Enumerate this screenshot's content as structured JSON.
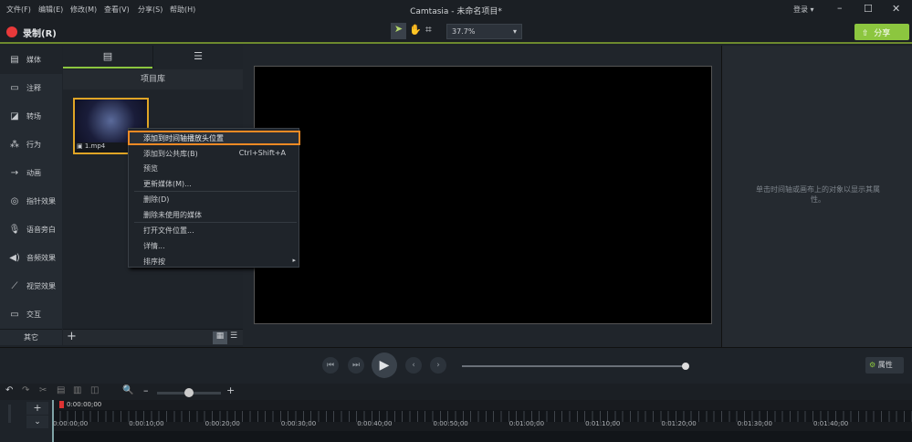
{
  "menu": [
    "文件(F)",
    "编辑(E)",
    "修改(M)",
    "查看(V)",
    "分享(S)",
    "帮助(H)"
  ],
  "title": "Camtasia - 未命名项目*",
  "login": "登录 ▾",
  "record": "录制(R)",
  "zoom": "37.7%",
  "share": "分享",
  "sidebar": [
    "媒体",
    "注释",
    "转场",
    "行为",
    "动画",
    "指针效果",
    "语音旁白",
    "音频效果",
    "视觉效果",
    "交互"
  ],
  "sidebar_more": "其它",
  "media": {
    "header": "项目库",
    "clip": "1.mp4"
  },
  "context_menu": [
    {
      "label": "添加到时间轴播放头位置",
      "shortcut": ""
    },
    {
      "label": "添加到公共库(B)",
      "shortcut": "Ctrl+Shift+A"
    },
    {
      "label": "预览",
      "shortcut": ""
    },
    {
      "label": "更新媒体(M)...",
      "shortcut": ""
    },
    {
      "label": "删除(D)",
      "shortcut": ""
    },
    {
      "label": "删除未使用的媒体",
      "shortcut": ""
    },
    {
      "label": "打开文件位置...",
      "shortcut": ""
    },
    {
      "label": "详情...",
      "shortcut": ""
    },
    {
      "label": "排序按",
      "shortcut": "▸"
    }
  ],
  "props_hint": "单击时间轴或画布上的对象以显示其属性。",
  "props_button": "属性",
  "playhead_time": "0:00:00;00",
  "ruler": [
    "0:00:00;00",
    "0:00:10;00",
    "0:00:20;00",
    "0:00:30;00",
    "0:00:40;00",
    "0:00:50;00",
    "0:01:00;00",
    "0:01:10;00",
    "0:01:20;00",
    "0:01:30;00",
    "0:01:40;00"
  ],
  "colors": {
    "accent": "#8cc63f",
    "highlight": "#f08a24",
    "record": "#e8393a"
  }
}
